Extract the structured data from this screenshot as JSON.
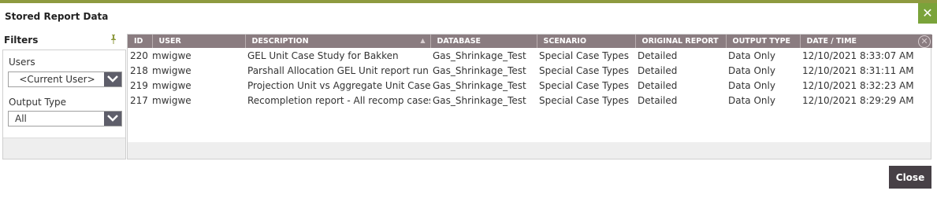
{
  "dialog": {
    "title": "Stored Report Data",
    "close_x": "✕",
    "close_button": "Close",
    "accent_color": "#8e9a3f",
    "close_x_color": "#7aa33a"
  },
  "filters": {
    "title": "Filters",
    "pin_icon": "pin-icon",
    "users_label": "Users",
    "users_value": "<Current User>",
    "output_type_label": "Output Type",
    "output_type_value": "All"
  },
  "table": {
    "header_color": "#8a7c80",
    "columns": [
      "ID",
      "USER",
      "DESCRIPTION",
      "DATABASE",
      "SCENARIO",
      "ORIGINAL REPORT",
      "OUTPUT TYPE",
      "DATE / TIME"
    ],
    "rows": [
      {
        "id": "220",
        "user": "mwigwe",
        "description": "GEL Unit Case Study for Bakken",
        "database": "Gas_Shrinkage_Test",
        "scenario": "Special Case Types",
        "original_report": "Detailed",
        "output_type": "Data Only",
        "datetime": "12/10/2021 8:33:07 AM"
      },
      {
        "id": "218",
        "user": "mwigwe",
        "description": "Parshall Allocation GEL Unit report run",
        "database": "Gas_Shrinkage_Test",
        "scenario": "Special Case Types",
        "original_report": "Detailed",
        "output_type": "Data Only",
        "datetime": "12/10/2021 8:31:11 AM"
      },
      {
        "id": "219",
        "user": "mwigwe",
        "description": "Projection Unit vs Aggregate Unit Cases",
        "database": "Gas_Shrinkage_Test",
        "scenario": "Special Case Types",
        "original_report": "Detailed",
        "output_type": "Data Only",
        "datetime": "12/10/2021 8:32:23 AM"
      },
      {
        "id": "217",
        "user": "mwigwe",
        "description": "Recompletion report - All recomp cases",
        "database": "Gas_Shrinkage_Test",
        "scenario": "Special Case Types",
        "original_report": "Detailed",
        "output_type": "Data Only",
        "datetime": "12/10/2021 8:29:29 AM"
      }
    ]
  }
}
